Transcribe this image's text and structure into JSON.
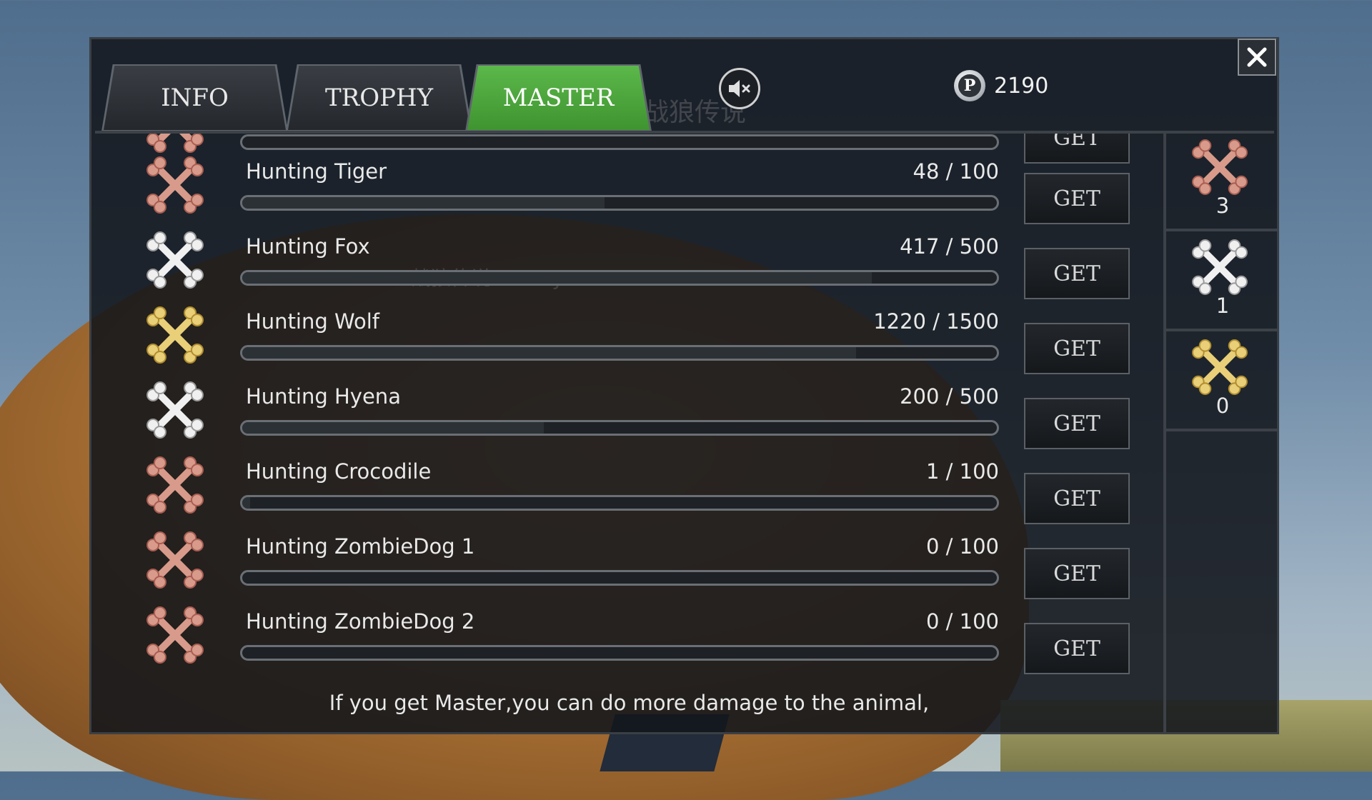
{
  "tabs": [
    {
      "label": "INFO",
      "active": false
    },
    {
      "label": "TROPHY",
      "active": false
    },
    {
      "label": "MASTER",
      "active": true
    }
  ],
  "watermarks": {
    "top": "战狼传说",
    "list": "战狼传说's Baby"
  },
  "points": {
    "value": "2190",
    "icon": "P"
  },
  "colors": {
    "accent": "#4aa83a",
    "bronze": "#c07a6a",
    "silver": "#c9c9c9",
    "gold": "#d4b04a"
  },
  "rows": [
    {
      "title": "",
      "count": "",
      "progress": 0.0,
      "tier": "bronze",
      "button": "GET"
    },
    {
      "title": "Hunting Tiger",
      "count": "48 / 100",
      "progress": 0.48,
      "tier": "bronze",
      "button": "GET"
    },
    {
      "title": "Hunting Fox",
      "count": "417 / 500",
      "progress": 0.834,
      "tier": "silver",
      "button": "GET"
    },
    {
      "title": "Hunting Wolf",
      "count": "1220 / 1500",
      "progress": 0.813,
      "tier": "gold",
      "button": "GET"
    },
    {
      "title": "Hunting Hyena",
      "count": "200 / 500",
      "progress": 0.4,
      "tier": "silver",
      "button": "GET"
    },
    {
      "title": "Hunting Crocodile",
      "count": "1 / 100",
      "progress": 0.01,
      "tier": "bronze",
      "button": "GET"
    },
    {
      "title": "Hunting ZombieDog 1",
      "count": "0 / 100",
      "progress": 0.0,
      "tier": "bronze",
      "button": "GET"
    },
    {
      "title": "Hunting ZombieDog 2",
      "count": "0 / 100",
      "progress": 0.0,
      "tier": "bronze",
      "button": "GET"
    }
  ],
  "sidebar": [
    {
      "tier": "bronze",
      "count": "3"
    },
    {
      "tier": "silver",
      "count": "1"
    },
    {
      "tier": "gold",
      "count": "0"
    }
  ],
  "footer": "If you get Master,you can do more damage to the animal,"
}
